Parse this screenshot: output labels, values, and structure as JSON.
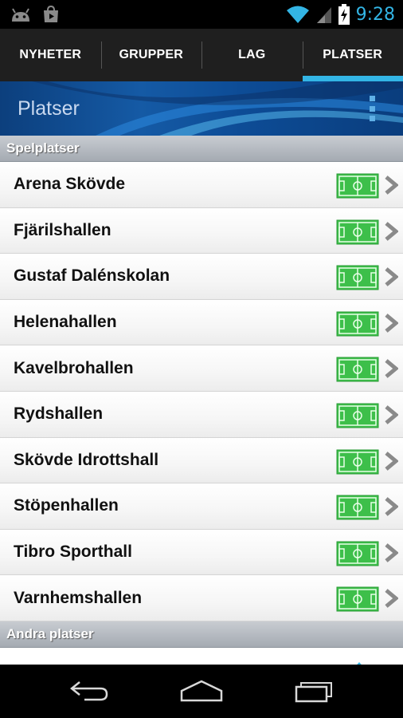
{
  "status_bar": {
    "time": "9:28",
    "icons": [
      "android-icon",
      "play-store-icon",
      "wifi-icon",
      "signal-icon",
      "battery-charging-icon"
    ]
  },
  "tabs": [
    {
      "label": "NYHETER",
      "active": false
    },
    {
      "label": "GRUPPER",
      "active": false
    },
    {
      "label": "LAG",
      "active": false
    },
    {
      "label": "PLATSER",
      "active": true
    }
  ],
  "action_bar": {
    "title": "Platser",
    "menu_icon": "overflow-menu-icon"
  },
  "sections": [
    {
      "header": "Spelplatser",
      "items": [
        "Arena Skövde",
        "Fjärilshallen",
        "Gustaf Dalénskolan",
        "Helenahallen",
        "Kavelbrohallen",
        "Rydshallen",
        "Skövde Idrottshall",
        "Stöpenhallen",
        "Tibro Sporthall",
        "Varnhemshallen"
      ]
    },
    {
      "header": "Andra platser",
      "items": []
    }
  ],
  "colors": {
    "accent": "#33b5e5",
    "field_green": "#3dbf4a",
    "tab_background": "#1f1f1f"
  },
  "nav_bar": {
    "icons": [
      "back-icon",
      "home-icon",
      "recent-apps-icon"
    ]
  }
}
